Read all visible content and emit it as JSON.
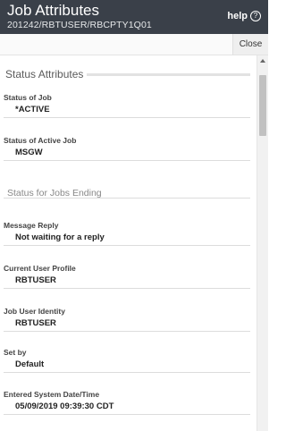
{
  "header": {
    "title": "Job Attributes",
    "subtitle": "201242/RBTUSER/RBCPTY1Q01",
    "help_label": "help",
    "help_icon_glyph": "?"
  },
  "toolbar": {
    "close_label": "Close"
  },
  "section": {
    "title": "Status Attributes"
  },
  "fields": {
    "status_of_job": {
      "label": "Status of Job",
      "value": "*ACTIVE"
    },
    "status_of_active_job": {
      "label": "Status of Active Job",
      "value": "MSGW"
    },
    "status_for_jobs_ending": {
      "label": "Status for Jobs Ending"
    },
    "message_reply": {
      "label": "Message Reply",
      "value": "Not waiting for a reply"
    },
    "current_user_profile": {
      "label": "Current User Profile",
      "value": "RBTUSER"
    },
    "job_user_identity": {
      "label": "Job User Identity",
      "value": "RBTUSER"
    },
    "set_by": {
      "label": "Set by",
      "value": "Default"
    },
    "entered_system_datetime": {
      "label": "Entered System Date/Time",
      "value": "05/09/2019 09:39:30 CDT"
    }
  },
  "colors": {
    "header_bg": "#3a4049",
    "scroll_thumb": "#c1c1c1"
  },
  "icons": {
    "help": "help-circle-icon",
    "scroll_up": "scroll-up-arrow-icon"
  }
}
